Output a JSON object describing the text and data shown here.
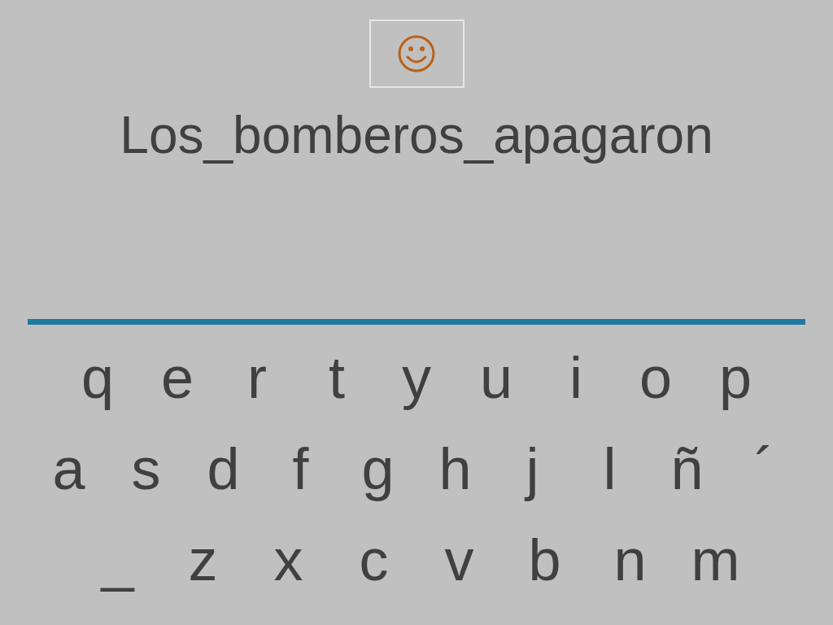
{
  "sentence": "Los_bomberos_apagaron",
  "keyboard": {
    "rows": [
      [
        "q",
        "e",
        "r",
        "t",
        "y",
        "u",
        "i",
        "o",
        "p"
      ],
      [
        "a",
        "s",
        "d",
        "f",
        "g",
        "h",
        "j",
        "l",
        "ñ",
        "´"
      ],
      [
        "_",
        "z",
        "x",
        "c",
        "v",
        "b",
        "n",
        "m"
      ]
    ]
  }
}
